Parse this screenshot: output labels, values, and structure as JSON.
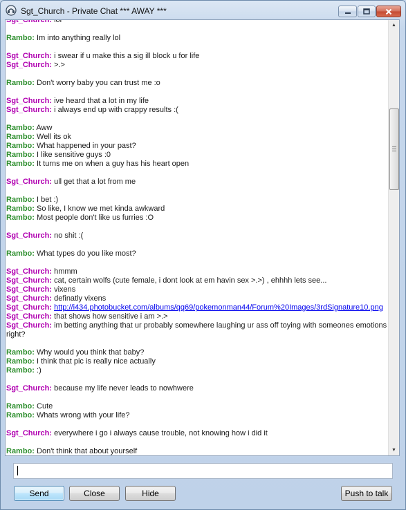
{
  "window": {
    "title": "Sgt_Church - Private Chat *** AWAY ***"
  },
  "chat": {
    "messages": [
      {
        "sender": "Sgt_Church",
        "text": "lol"
      },
      {
        "gap": true
      },
      {
        "sender": "Rambo",
        "text": "Im into anything really lol"
      },
      {
        "gap": true
      },
      {
        "sender": "Sgt_Church",
        "text": "i swear if u make this a sig ill block u for life"
      },
      {
        "sender": "Sgt_Church",
        "text": ">.>"
      },
      {
        "gap": true
      },
      {
        "sender": "Rambo",
        "text": "Don't worry baby you can trust me :o"
      },
      {
        "gap": true
      },
      {
        "sender": "Sgt_Church",
        "text": "ive heard that a lot in my life"
      },
      {
        "sender": "Sgt_Church",
        "text": "i always end up with crappy results :("
      },
      {
        "gap": true
      },
      {
        "sender": "Rambo",
        "text": "Aww"
      },
      {
        "sender": "Rambo",
        "text": "Well its ok"
      },
      {
        "sender": "Rambo",
        "text": "What happened in your past?"
      },
      {
        "sender": "Rambo",
        "text": "I like sensitive guys :0"
      },
      {
        "sender": "Rambo",
        "text": "It turns me on when a guy has his heart open"
      },
      {
        "gap": true
      },
      {
        "sender": "Sgt_Church",
        "text": "ull get that a lot from me"
      },
      {
        "gap": true
      },
      {
        "sender": "Rambo",
        "text": "I bet :)"
      },
      {
        "sender": "Rambo",
        "text": "So like, I know we met kinda awkward"
      },
      {
        "sender": "Rambo",
        "text": "Most people don't like us furries :O"
      },
      {
        "gap": true
      },
      {
        "sender": "Sgt_Church",
        "text": "no shit :("
      },
      {
        "gap": true
      },
      {
        "sender": "Rambo",
        "text": "What types do you like most?"
      },
      {
        "gap": true
      },
      {
        "sender": "Sgt_Church",
        "text": "hmmm"
      },
      {
        "sender": "Sgt_Church",
        "text": "cat, certain wolfs (cute female, i dont look at em havin sex >.>) , ehhhh lets see..."
      },
      {
        "sender": "Sgt_Church",
        "text": "vixens"
      },
      {
        "sender": "Sgt_Church",
        "text": "definatly vixens"
      },
      {
        "sender": "Sgt_Church",
        "text": "http://i434.photobucket.com/albums/qq69/pokemonman44/Forum%20Images/3rdSignature10.png",
        "link": true
      },
      {
        "sender": "Sgt_Church",
        "text": "that shows how sensitive i am >.>"
      },
      {
        "sender": "Sgt_Church",
        "text": "im betting anything that ur probably somewhere laughing ur ass off toying with someones emotions right?",
        "wrap": true
      },
      {
        "gap": true
      },
      {
        "sender": "Rambo",
        "text": "Why would you think that baby?"
      },
      {
        "sender": "Rambo",
        "text": "I think that pic is really nice actually"
      },
      {
        "sender": "Rambo",
        "text": ":)"
      },
      {
        "gap": true
      },
      {
        "sender": "Sgt_Church",
        "text": "because my life never leads to nowhwere"
      },
      {
        "gap": true
      },
      {
        "sender": "Rambo",
        "text": "Cute"
      },
      {
        "sender": "Rambo",
        "text": "Whats wrong with your life?"
      },
      {
        "gap": true
      },
      {
        "sender": "Sgt_Church",
        "text": "everywhere i go i always cause trouble, not knowing how i did it"
      },
      {
        "gap": true
      },
      {
        "sender": "Rambo",
        "text": "Don't think that about yourself"
      }
    ]
  },
  "input": {
    "value": "",
    "placeholder": ""
  },
  "buttons": {
    "send": "Send",
    "close": "Close",
    "hide": "Hide",
    "push_to_talk": "Push to talk"
  },
  "colors": {
    "sgt_church": "#b100b1",
    "rambo": "#2f8f2f",
    "link": "#0000ee"
  }
}
